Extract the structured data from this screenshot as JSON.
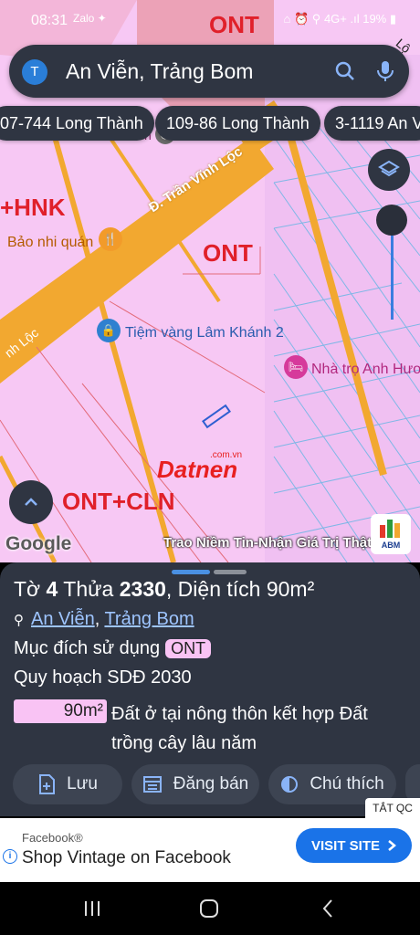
{
  "status": {
    "time": "08:31",
    "left_icons": "Zalo ✦",
    "right_icons": "⌂ ⏰ ⚲ 4G+ .ıl 19% ▮",
    "battery": "19%"
  },
  "search": {
    "avatar_letter": "T",
    "query": "An Viễn, Trảng Bom"
  },
  "chips": [
    "07-744 Long Thành",
    "109-86 Long Thành",
    "3-1119 An V"
  ],
  "map": {
    "top_label": "ONT",
    "top_right_label": "Lộ",
    "zone_hnk": "+HNK",
    "street_main": "Đ. Trần Vĩnh Lộc",
    "street_left": "nh Lộc",
    "zone_ont": "ONT",
    "zone_ont_cln": "ONT+CLN",
    "poi_food": "Bảo nhi quán",
    "poi_gold": "Tiệm vàng Lâm Khánh 2",
    "poi_hotel": "Nhà trọ Anh Hươ",
    "poi_partial": "n",
    "watermark": "Datnen",
    "watermark_small": ".com.vn",
    "slogan": "Trao Niềm Tin-Nhận Giá Trị Thật",
    "abm": "ABM",
    "google": "Google"
  },
  "panel": {
    "title_prefix": "Tờ ",
    "sheet": "4",
    "title_mid": " Thửa ",
    "parcel": "2330",
    "title_area": ", Diện tích 90m²",
    "location_ward": "An Viễn",
    "location_sep": ", ",
    "location_district": "Trảng Bom",
    "purpose_label": "Mục đích sử dụng",
    "purpose_value": "ONT",
    "plan_label": "Quy hoạch SDĐ 2030",
    "area_badge": "90m²",
    "area_desc": "Đất ở tại nông thôn kết hợp Đất trồng cây lâu năm",
    "actions": {
      "save": "Lưu",
      "post": "Đăng bán",
      "legend": "Chú thích"
    }
  },
  "ad": {
    "close_label": "TẮT QC",
    "brand": "Facebook®",
    "headline": "Shop Vintage on Facebook",
    "cta": "VISIT SITE"
  },
  "colors": {
    "map_pink": "#f7c8f4",
    "road_orange": "#f2a830",
    "label_red": "#e0202a",
    "panel_bg": "#2f3542",
    "accent_blue": "#1a73e8"
  }
}
